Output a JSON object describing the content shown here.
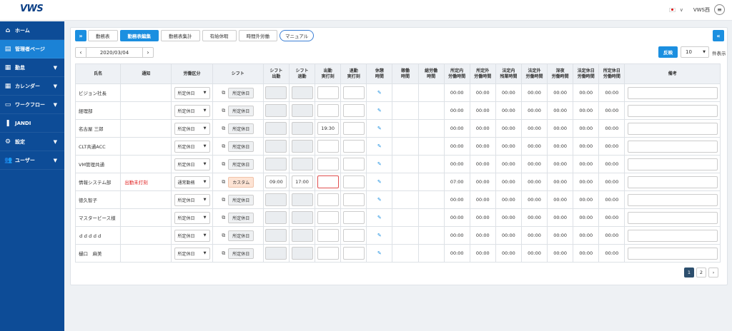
{
  "header": {
    "logo": "VWS",
    "user": "VWS西",
    "lang_chevron": "∨",
    "menu_icon": "≡"
  },
  "sidebar": {
    "items": [
      {
        "label": "ホーム",
        "icon": "home-icon",
        "glyph": "⌂",
        "chevron": false
      },
      {
        "label": "管理者ページ",
        "icon": "admin-icon",
        "glyph": "▤",
        "chevron": false,
        "active": true
      },
      {
        "label": "勤怠",
        "icon": "calendar-check-icon",
        "glyph": "▦",
        "chevron": true
      },
      {
        "label": "カレンダー",
        "icon": "calendar-icon",
        "glyph": "▦",
        "chevron": true
      },
      {
        "label": "ワークフロー",
        "icon": "workflow-icon",
        "glyph": "▭",
        "chevron": true
      },
      {
        "label": "JANDI",
        "icon": "jandi-icon",
        "glyph": "❚",
        "chevron": false
      },
      {
        "label": "設定",
        "icon": "gear-icon",
        "glyph": "⚙",
        "chevron": true
      },
      {
        "label": "ユーザー",
        "icon": "users-icon",
        "glyph": "👥",
        "chevron": true
      }
    ]
  },
  "toolbar": {
    "expand": "»",
    "collapse": "«",
    "tabs": [
      "勤務表",
      "勤務表編集",
      "勤務表集計",
      "有給休暇",
      "時間外労働"
    ],
    "manual": "マニュアル",
    "date": "2020/03/04",
    "prev": "‹",
    "next": "›",
    "reflect": "反映",
    "per_page": "10",
    "per_page_label": "件表示"
  },
  "table": {
    "headers": [
      "氏名",
      "通知",
      "労働区分",
      "シフト",
      "シフト\n出勤",
      "シフト\n退勤",
      "出勤\n実打刻",
      "退勤\n実打刻",
      "休憩\n時間",
      "稼働\n時間",
      "総労働\n時間",
      "所定内\n労働時間",
      "所定外\n労働時間",
      "法定内\n残業時間",
      "法定外\n労働時間",
      "深夜\n労働時間",
      "法定休日\n労働時間",
      "所定休日\n労働時間",
      "備考"
    ],
    "rows": [
      {
        "name": "ビジョン社長",
        "notice": "",
        "category": "所定休日",
        "shift": "所定休日",
        "s_in": "",
        "s_out": "",
        "a_in": "",
        "a_out": "",
        "t1": "00:00",
        "t2": "00:00",
        "t3": "00:00",
        "t4": "00:00",
        "t5": "00:00",
        "t6": "00:00",
        "t7": "00:00"
      },
      {
        "name": "経理部",
        "notice": "",
        "category": "所定休日",
        "shift": "所定休日",
        "s_in": "",
        "s_out": "",
        "a_in": "",
        "a_out": "",
        "t1": "00:00",
        "t2": "00:00",
        "t3": "00:00",
        "t4": "00:00",
        "t5": "00:00",
        "t6": "00:00",
        "t7": "00:00"
      },
      {
        "name": "名古屋 三郎",
        "notice": "",
        "category": "所定休日",
        "shift": "所定休日",
        "s_in": "",
        "s_out": "",
        "a_in": "19:30",
        "a_out": "",
        "t1": "00:00",
        "t2": "00:00",
        "t3": "00:00",
        "t4": "00:00",
        "t5": "00:00",
        "t6": "00:00",
        "t7": "00:00"
      },
      {
        "name": "CLT共通ACC",
        "notice": "",
        "category": "所定休日",
        "shift": "所定休日",
        "s_in": "",
        "s_out": "",
        "a_in": "",
        "a_out": "",
        "t1": "00:00",
        "t2": "00:00",
        "t3": "00:00",
        "t4": "00:00",
        "t5": "00:00",
        "t6": "00:00",
        "t7": "00:00"
      },
      {
        "name": "VM管理共通",
        "notice": "",
        "category": "所定休日",
        "shift": "所定休日",
        "s_in": "",
        "s_out": "",
        "a_in": "",
        "a_out": "",
        "t1": "00:00",
        "t2": "00:00",
        "t3": "00:00",
        "t4": "00:00",
        "t5": "00:00",
        "t6": "00:00",
        "t7": "00:00"
      },
      {
        "name": "情報システム部",
        "notice": "出勤未打刻",
        "category": "通常勤務",
        "shift": "カスタム",
        "s_in": "09:00",
        "s_out": "17:00",
        "a_in": "",
        "a_out": "",
        "t1": "07:00",
        "t2": "00:00",
        "t3": "00:00",
        "t4": "00:00",
        "t5": "00:00",
        "t6": "00:00",
        "t7": "00:00",
        "custom": true,
        "error": true
      },
      {
        "name": "徳久智子",
        "notice": "",
        "category": "所定休日",
        "shift": "所定休日",
        "s_in": "",
        "s_out": "",
        "a_in": "",
        "a_out": "",
        "t1": "00:00",
        "t2": "00:00",
        "t3": "00:00",
        "t4": "00:00",
        "t5": "00:00",
        "t6": "00:00",
        "t7": "00:00"
      },
      {
        "name": "マスタービース様",
        "notice": "",
        "category": "所定休日",
        "shift": "所定休日",
        "s_in": "",
        "s_out": "",
        "a_in": "",
        "a_out": "",
        "t1": "00:00",
        "t2": "00:00",
        "t3": "00:00",
        "t4": "00:00",
        "t5": "00:00",
        "t6": "00:00",
        "t7": "00:00"
      },
      {
        "name": "ｄｄｄｄｄ",
        "notice": "",
        "category": "所定休日",
        "shift": "所定休日",
        "s_in": "",
        "s_out": "",
        "a_in": "",
        "a_out": "",
        "t1": "00:00",
        "t2": "00:00",
        "t3": "00:00",
        "t4": "00:00",
        "t5": "00:00",
        "t6": "00:00",
        "t7": "00:00"
      },
      {
        "name": "樋口　麻美",
        "notice": "",
        "category": "所定休日",
        "shift": "所定休日",
        "s_in": "",
        "s_out": "",
        "a_in": "",
        "a_out": "",
        "t1": "00:00",
        "t2": "00:00",
        "t3": "00:00",
        "t4": "00:00",
        "t5": "00:00",
        "t6": "00:00",
        "t7": "00:00"
      }
    ]
  },
  "pager": {
    "pages": [
      "1",
      "2"
    ],
    "next": "›",
    "current": "1"
  },
  "colors": {
    "accent": "#1b8fe0",
    "sidebar": "#0d4c97",
    "sidebar_active": "#1b82d6",
    "alert": "#e02020"
  }
}
